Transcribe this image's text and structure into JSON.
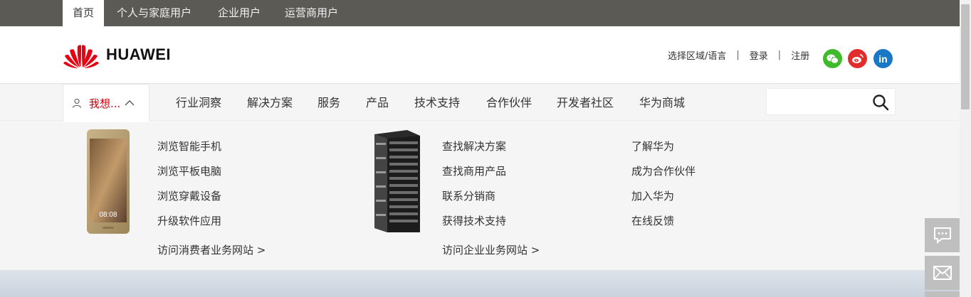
{
  "top_tabs": [
    {
      "label": "首页",
      "active": true
    },
    {
      "label": "个人与家庭用户",
      "active": false
    },
    {
      "label": "企业用户",
      "active": false
    },
    {
      "label": "运营商用户",
      "active": false
    }
  ],
  "header": {
    "logo_text": "HUAWEI",
    "region_label": "选择区域/语言",
    "login_label": "登录",
    "register_label": "注册",
    "separator": "|",
    "social": [
      {
        "name": "wechat-icon",
        "color": "#3fba2a"
      },
      {
        "name": "weibo-icon",
        "color": "#e32d2d"
      },
      {
        "name": "linkedin-icon",
        "color": "#1978c5",
        "glyph": "in"
      }
    ]
  },
  "nav": {
    "want_label": "我想...",
    "items": [
      "行业洞察",
      "解决方案",
      "服务",
      "产品",
      "技术支持",
      "合作伙伴",
      "开发者社区",
      "华为商城"
    ],
    "search": {
      "placeholder": "",
      "value": ""
    }
  },
  "mega": {
    "consumer_links": [
      "浏览智能手机",
      "浏览平板电脑",
      "浏览穿戴设备",
      "升级软件应用"
    ],
    "consumer_visit": "访问消费者业务网站 >",
    "enterprise_links": [
      "查找解决方案",
      "查找商用产品",
      "联系分销商",
      "获得技术支持"
    ],
    "enterprise_visit": "访问企业业务网站 >",
    "about_links": [
      "了解华为",
      "成为合作伙伴",
      "加入华为",
      "在线反馈"
    ],
    "phone_time": "08:08"
  },
  "colors": {
    "topbar": "#5c5a55",
    "brand_red": "#c7000b",
    "nav_bg": "#f5f5f5"
  }
}
